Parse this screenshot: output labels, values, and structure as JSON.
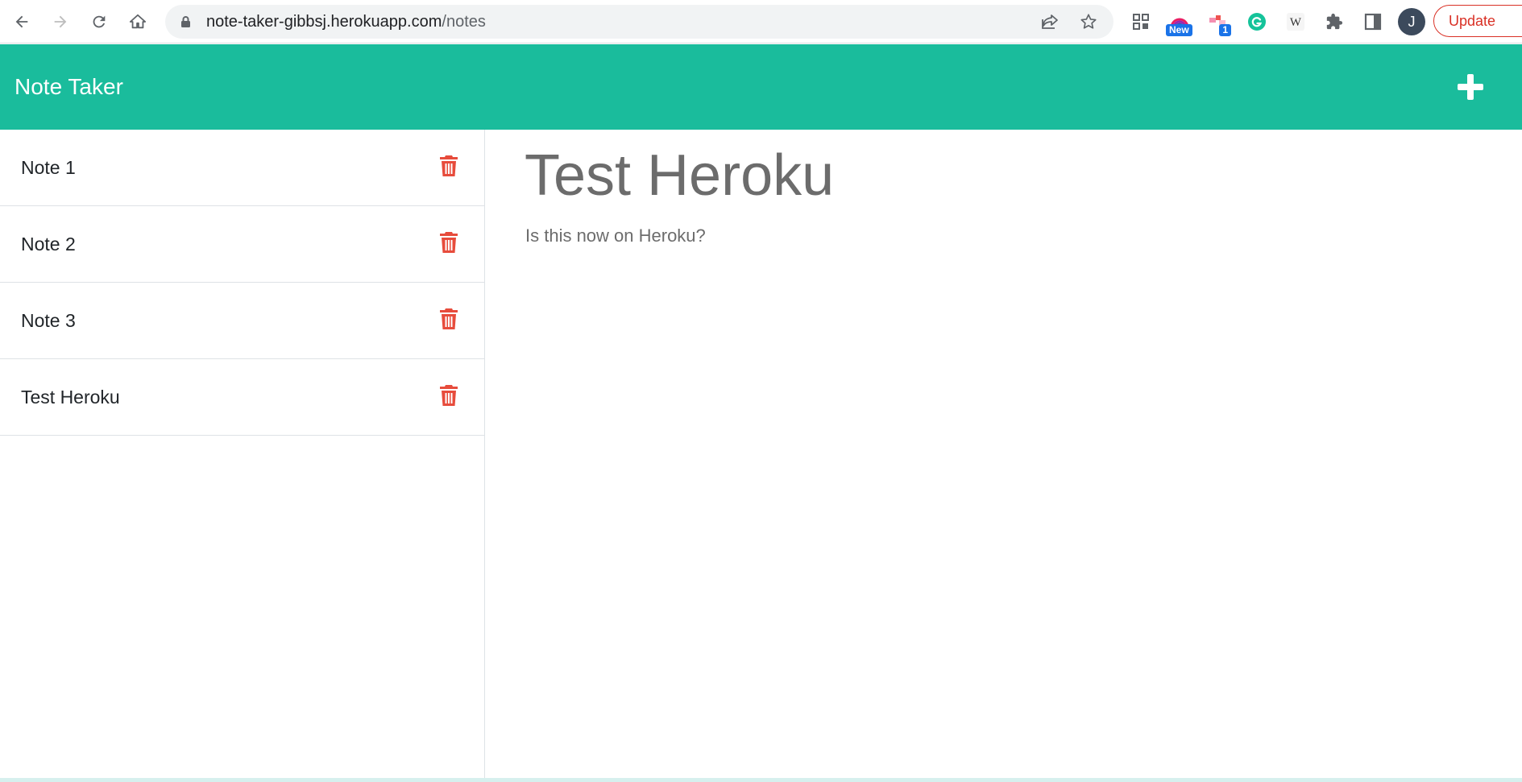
{
  "browser": {
    "url_host": "note-taker-gibbsj.herokuapp.com",
    "url_path": "/notes",
    "update_label": "Update",
    "extension_badge_new": "New",
    "extension_badge_count": "1",
    "profile_initial": "J"
  },
  "app": {
    "title": "Note Taker",
    "accent_color": "#1abc9c",
    "delete_color": "#e74c3c"
  },
  "notes": [
    {
      "title": "Note 1"
    },
    {
      "title": "Note 2"
    },
    {
      "title": "Note 3"
    },
    {
      "title": "Test Heroku"
    }
  ],
  "active_note": {
    "title": "Test Heroku",
    "text": "Is this now on Heroku?"
  }
}
